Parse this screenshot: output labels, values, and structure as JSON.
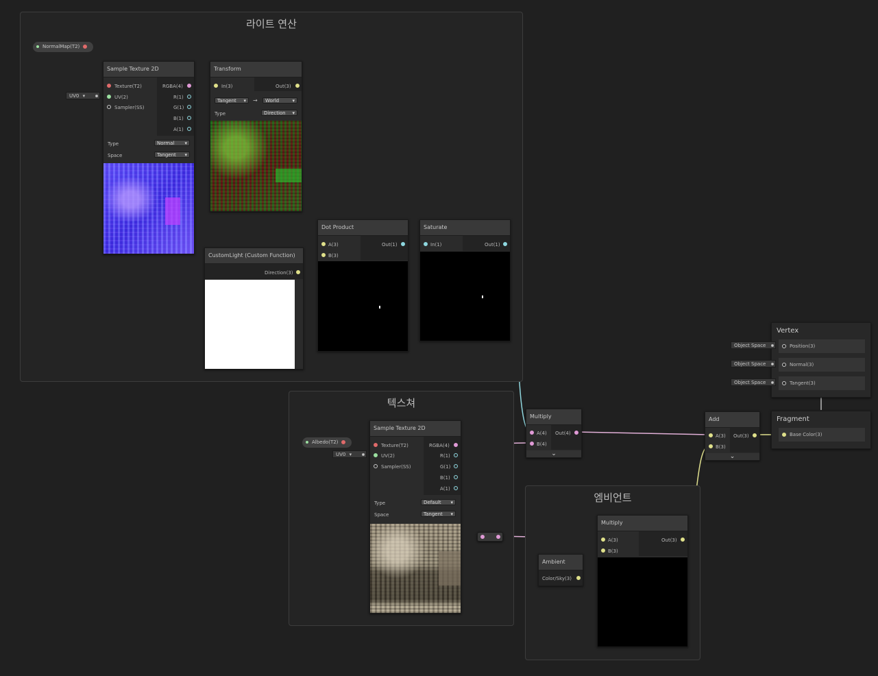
{
  "groups": {
    "light": "라이트 연산",
    "texture": "텍스쳐",
    "ambient": "엠비언트"
  },
  "properties": {
    "normal_map": "NormalMap(T2)",
    "albedo": "Albedo(T2)"
  },
  "uv_chip": "UV0",
  "sample_normal": {
    "title": "Sample Texture 2D",
    "inputs": [
      "Texture(T2)",
      "UV(2)",
      "Sampler(SS)"
    ],
    "outputs": [
      "RGBA(4)",
      "R(1)",
      "G(1)",
      "B(1)",
      "A(1)"
    ],
    "type_label": "Type",
    "type_value": "Normal",
    "space_label": "Space",
    "space_value": "Tangent"
  },
  "transform": {
    "title": "Transform",
    "input": "In(3)",
    "output": "Out(3)",
    "from": "Tangent",
    "to": "World",
    "type_label": "Type",
    "type_value": "Direction"
  },
  "custom_light": {
    "title": "CustomLight (Custom Function)",
    "output": "Direction(3)"
  },
  "dot_product": {
    "title": "Dot Product",
    "inputs": [
      "A(3)",
      "B(3)"
    ],
    "output": "Out(1)"
  },
  "saturate": {
    "title": "Saturate",
    "input": "In(1)",
    "output": "Out(1)"
  },
  "sample_albedo": {
    "title": "Sample Texture 2D",
    "inputs": [
      "Texture(T2)",
      "UV(2)",
      "Sampler(SS)"
    ],
    "outputs": [
      "RGBA(4)",
      "R(1)",
      "G(1)",
      "B(1)",
      "A(1)"
    ],
    "type_label": "Type",
    "type_value": "Default",
    "space_label": "Space",
    "space_value": "Tangent"
  },
  "multiply_main": {
    "title": "Multiply",
    "inputs": [
      "A(4)",
      "B(4)"
    ],
    "output": "Out(4)"
  },
  "add": {
    "title": "Add",
    "inputs": [
      "A(3)",
      "B(3)"
    ],
    "output": "Out(3)"
  },
  "multiply_ambient": {
    "title": "Multiply",
    "inputs": [
      "A(3)",
      "B(3)"
    ],
    "output": "Out(3)"
  },
  "ambient": {
    "title": "Ambient",
    "output": "Color/Sky(3)"
  },
  "vertex": {
    "title": "Vertex",
    "rows": [
      "Position(3)",
      "Normal(3)",
      "Tangent(3)"
    ],
    "space": "Object Space"
  },
  "fragment": {
    "title": "Fragment",
    "rows": [
      "Base Color(3)"
    ]
  },
  "colors": {
    "background": "#202020",
    "wire_texture": "#e07a7a",
    "wire_vec4": "#e2b0d8",
    "wire_vec3": "#e0e08e",
    "wire_vec2": "#a0e0a4",
    "wire_vec1": "#90d6de"
  },
  "icons": {
    "arrow": "→",
    "expand": "chevron-down-icon"
  }
}
